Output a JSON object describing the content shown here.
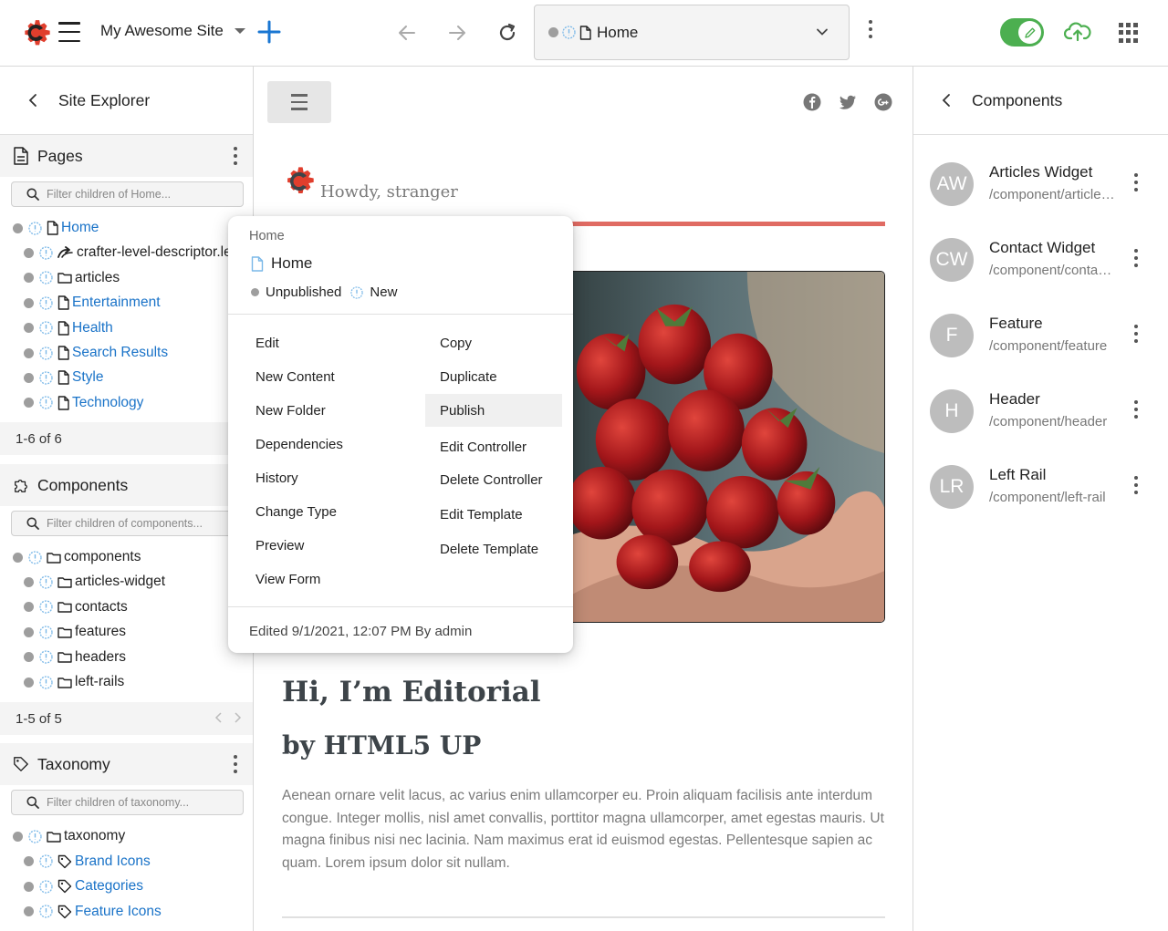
{
  "topbar": {
    "site_name": "My Awesome Site",
    "url_text": "Home"
  },
  "sidebar": {
    "title": "Site Explorer",
    "pages": {
      "title": "Pages",
      "filter_placeholder": "Filter children of Home...",
      "items": [
        {
          "label": "Home",
          "icon": "page-icon",
          "link": true
        },
        {
          "label": "crafter-level-descriptor.le",
          "icon": "level-descriptor-icon",
          "link": false
        },
        {
          "label": "articles",
          "icon": "folder-icon",
          "link": false
        },
        {
          "label": "Entertainment",
          "icon": "page-icon",
          "link": true
        },
        {
          "label": "Health",
          "icon": "page-icon",
          "link": true
        },
        {
          "label": "Search Results",
          "icon": "page-icon",
          "link": true
        },
        {
          "label": "Style",
          "icon": "page-icon",
          "link": true
        },
        {
          "label": "Technology",
          "icon": "page-icon",
          "link": true
        }
      ],
      "pager": "1-6 of 6"
    },
    "components": {
      "title": "Components",
      "filter_placeholder": "Filter children of components...",
      "items": [
        {
          "label": "components",
          "icon": "folder-icon"
        },
        {
          "label": "articles-widget",
          "icon": "folder-icon"
        },
        {
          "label": "contacts",
          "icon": "folder-icon"
        },
        {
          "label": "features",
          "icon": "folder-icon"
        },
        {
          "label": "headers",
          "icon": "folder-icon"
        },
        {
          "label": "left-rails",
          "icon": "folder-icon"
        }
      ],
      "pager": "1-5 of 5"
    },
    "taxonomy": {
      "title": "Taxonomy",
      "filter_placeholder": "Filter children of taxonomy...",
      "items": [
        {
          "label": "taxonomy",
          "icon": "folder-icon",
          "link": false
        },
        {
          "label": "Brand Icons",
          "icon": "tag-icon",
          "link": true
        },
        {
          "label": "Categories",
          "icon": "tag-icon",
          "link": true
        },
        {
          "label": "Feature Icons",
          "icon": "tag-icon",
          "link": true
        }
      ]
    }
  },
  "preview": {
    "greeting": "Howdy, stranger",
    "heading1": "Hi, I’m Editorial",
    "heading2": "by HTML5 UP",
    "paragraph": "Aenean ornare velit lacus, ac varius enim ullamcorper eu. Proin aliquam facilisis ante interdum congue. Integer mollis, nisl amet convallis, porttitor magna ullamcorper, amet egestas mauris. Ut magna finibus nisi nec lacinia. Nam maximus erat id euismod egestas. Pellentesque sapien ac quam. Lorem ipsum dolor sit nullam."
  },
  "components_panel": {
    "title": "Components",
    "items": [
      {
        "initials": "AW",
        "name": "Articles Widget",
        "path": "/component/articles-widget"
      },
      {
        "initials": "CW",
        "name": "Contact Widget",
        "path": "/component/contact-widget"
      },
      {
        "initials": "F",
        "name": "Feature",
        "path": "/component/feature"
      },
      {
        "initials": "H",
        "name": "Header",
        "path": "/component/header"
      },
      {
        "initials": "LR",
        "name": "Left Rail",
        "path": "/component/left-rail"
      }
    ]
  },
  "context_menu": {
    "breadcrumb": "Home",
    "title": "Home",
    "status_unpublished": "Unpublished",
    "status_new": "New",
    "left_items": [
      "Edit",
      "New Content",
      "New Folder",
      "Dependencies",
      "History",
      "Change Type",
      "Preview",
      "View Form"
    ],
    "right_items": [
      "Copy",
      "Duplicate",
      "Publish",
      "Edit Controller",
      "Delete Controller",
      "Edit Template",
      "Delete Template"
    ],
    "footer": "Edited 9/1/2021, 12:07 PM By admin"
  },
  "colors": {
    "brand_red": "#e03e2d",
    "link_blue": "#1a73c8",
    "accent_blue": "#1976d2",
    "toggle_green": "#4caf50",
    "info_blue": "#7ab8e8",
    "rule_red": "#e06b63"
  }
}
